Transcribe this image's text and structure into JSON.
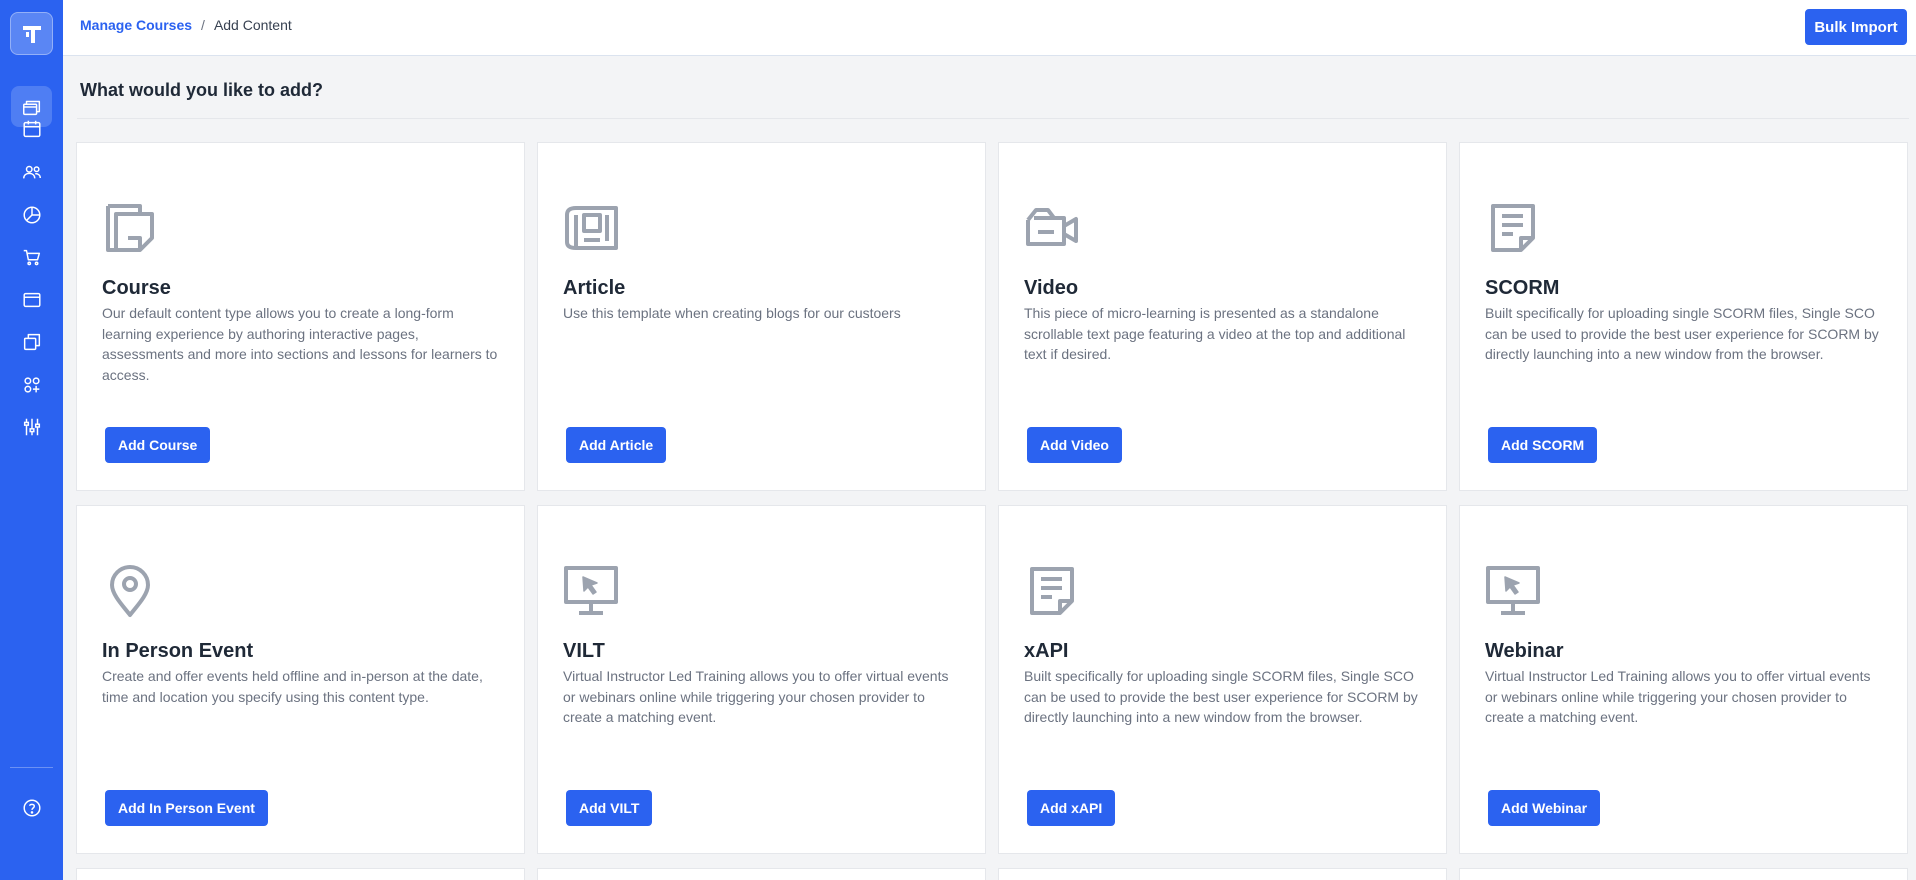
{
  "header": {
    "breadcrumb": {
      "parent": "Manage Courses",
      "separator": "/",
      "current": "Add Content"
    },
    "bulk_import_label": "Bulk Import"
  },
  "main": {
    "title": "What would you like to add?",
    "cards": [
      {
        "icon": "document-icon",
        "title": "Course",
        "description": "Our default content type allows you to create a long-form learning experience by authoring interactive pages, assessments and more into sections and lessons for learners to access.",
        "button": "Add Course"
      },
      {
        "icon": "newspaper-icon",
        "title": "Article",
        "description": "Use this template when creating blogs for our custoers",
        "button": "Add Article"
      },
      {
        "icon": "video-camera-icon",
        "title": "Video",
        "description": "This piece of micro-learning is presented as a standalone scrollable text page featuring a video at the top and additional text if desired.",
        "button": "Add Video"
      },
      {
        "icon": "file-text-icon",
        "title": "SCORM",
        "description": "Built specifically for uploading single SCORM files, Single SCO can be used to provide the best user experience for SCORM by directly launching into a new window from the browser.",
        "button": "Add SCORM"
      },
      {
        "icon": "location-pin-icon",
        "title": "In Person Event",
        "description": "Create and offer events held offline and in-person at the date, time and location you specify using this content type.",
        "button": "Add In Person Event"
      },
      {
        "icon": "monitor-cursor-icon",
        "title": "VILT",
        "description": "Virtual Instructor Led Training allows you to offer virtual events or webinars online while triggering your chosen provider to create a matching event.",
        "button": "Add VILT"
      },
      {
        "icon": "file-text-icon",
        "title": "xAPI",
        "description": "Built specifically for uploading single SCORM files, Single SCO can be used to provide the best user experience for SCORM by directly launching into a new window from the browser.",
        "button": "Add xAPI"
      },
      {
        "icon": "monitor-cursor-icon",
        "title": "Webinar",
        "description": "Virtual Instructor Led Training allows you to offer virtual events or webinars online while triggering your chosen provider to create a matching event.",
        "button": "Add Webinar"
      }
    ]
  },
  "sidebar": {
    "items": [
      {
        "icon": "courses-icon",
        "active": true
      },
      {
        "icon": "calendar-icon",
        "active": false
      },
      {
        "icon": "users-icon",
        "active": false
      },
      {
        "icon": "pie-chart-icon",
        "active": false
      },
      {
        "icon": "cart-icon",
        "active": false
      },
      {
        "icon": "browser-window-icon",
        "active": false
      },
      {
        "icon": "stacked-pages-icon",
        "active": false
      },
      {
        "icon": "apps-add-icon",
        "active": false
      },
      {
        "icon": "sliders-icon",
        "active": false
      }
    ],
    "footer_icon": "help-icon"
  },
  "colors": {
    "brand": "#2b62f0",
    "sidebar_active": "#4f7ef3",
    "page_background": "#f3f4f6",
    "card_background": "#ffffff",
    "text_primary": "#1f2937",
    "text_muted": "#6b7280",
    "icon_gray": "#9ca3af"
  }
}
